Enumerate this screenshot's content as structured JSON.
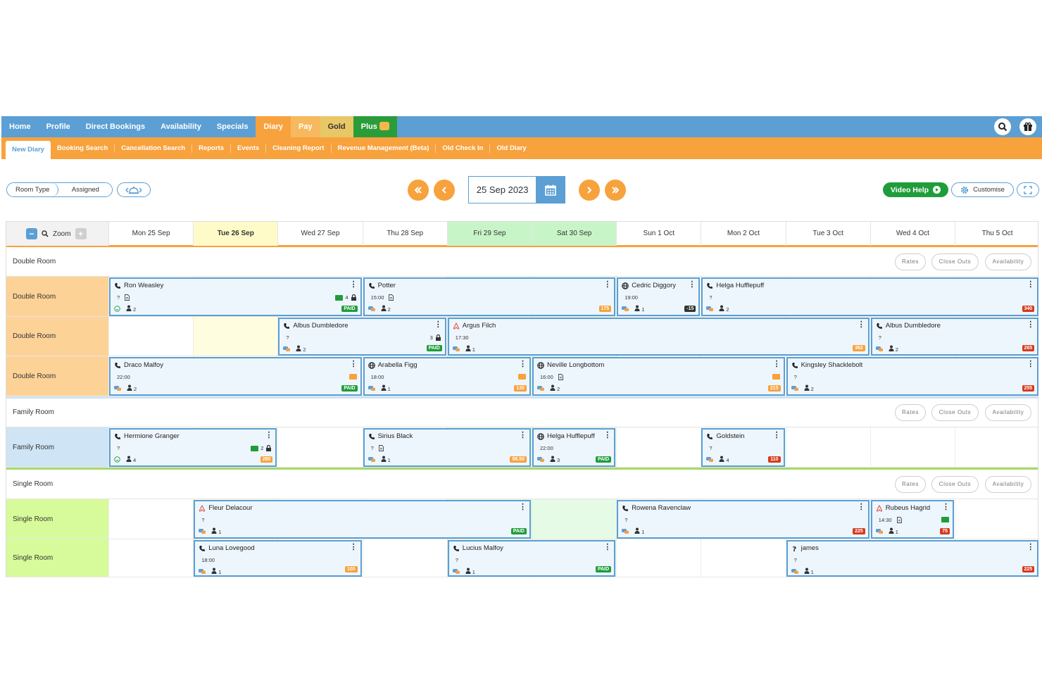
{
  "nav": {
    "items": [
      "Home",
      "Profile",
      "Direct Bookings",
      "Availability",
      "Specials",
      "Diary",
      "Pay",
      "Gold",
      "Plus"
    ]
  },
  "subnav": {
    "items": [
      "New Diary",
      "Booking Search",
      "Cancellation Search",
      "Reports",
      "Events",
      "Cleaning Report",
      "Revenue Management (Beta)",
      "Old Check In",
      "Old Diary"
    ]
  },
  "toolbar": {
    "room_type": "Room Type",
    "assigned": "Assigned",
    "date": "25 Sep 2023",
    "video_help": "Video Help",
    "customise": "Customise"
  },
  "grid": {
    "zoom_label": "Zoom",
    "days": [
      "Mon 25 Sep",
      "Tue 26 Sep",
      "Wed 27 Sep",
      "Thu 28 Sep",
      "Fri 29 Sep",
      "Sat 30 Sep",
      "Sun 1 Oct",
      "Mon 2 Oct",
      "Tue 3 Oct",
      "Wed 4 Oct",
      "Thu 5 Oct"
    ],
    "section_buttons": [
      "Rates",
      "Close Outs",
      "Availability"
    ],
    "sections": [
      {
        "title": "Double Room",
        "rooms": [
          "Double Room",
          "Double Room",
          "Double Room"
        ],
        "color": "#fdd297"
      },
      {
        "title": "Family Room",
        "rooms": [
          "Family Room"
        ],
        "color": "#cfe4f4"
      },
      {
        "title": "Single Room",
        "rooms": [
          "Single Room",
          "Single Room"
        ],
        "color": "#d7fb9a"
      }
    ]
  },
  "bookings": [
    {
      "name": "Ron Weasley",
      "time": "?",
      "guests": "2",
      "price": "PAID",
      "pc": "green",
      "extra": "4",
      "src": "phone"
    },
    {
      "name": "Potter",
      "time": "15:00",
      "guests": "2",
      "price": "175",
      "pc": "orange",
      "src": "phone"
    },
    {
      "name": "Cedric Diggory",
      "time": "19:00",
      "guests": "1",
      "price": "-15",
      "pc": "dark",
      "src": "globe"
    },
    {
      "name": "Helga Hufflepuff",
      "time": "?",
      "guests": "2",
      "price": "340",
      "pc": "red",
      "src": "phone"
    },
    {
      "name": "Albus Dumbledore",
      "time": "?",
      "guests": "2",
      "price": "PAID",
      "pc": "green",
      "extra": "3",
      "src": "phone"
    },
    {
      "name": "Argus Filch",
      "time": "17:30",
      "guests": "1",
      "price": "362",
      "pc": "orange",
      "src": "airbnb"
    },
    {
      "name": "Albus Dumbledore",
      "time": "?",
      "guests": "2",
      "price": "265",
      "pc": "red",
      "src": "phone"
    },
    {
      "name": "Draco Malfoy",
      "time": "22:00",
      "guests": "2",
      "price": "PAID",
      "pc": "green",
      "src": "phone"
    },
    {
      "name": "Arabella Figg",
      "time": "18:00",
      "guests": "1",
      "price": "130",
      "pc": "orange",
      "src": "globe"
    },
    {
      "name": "Neville Longbottom",
      "time": "16:00",
      "guests": "2",
      "price": "215",
      "pc": "orange",
      "src": "globe"
    },
    {
      "name": "Kingsley Shacklebolt",
      "time": "?",
      "guests": "2",
      "price": "255",
      "pc": "red",
      "src": "phone"
    },
    {
      "name": "Hermione Granger",
      "time": "?",
      "guests": "4",
      "price": "280",
      "pc": "orange",
      "extra": "2",
      "src": "phone"
    },
    {
      "name": "Sirius Black",
      "time": "?",
      "guests": "1",
      "price": "58.50",
      "pc": "orange",
      "src": "phone"
    },
    {
      "name": "Helga Hufflepuff",
      "time": "22:00",
      "guests": "3",
      "price": "PAID",
      "pc": "green",
      "src": "globe"
    },
    {
      "name": "Goldstein",
      "time": "?",
      "guests": "4",
      "price": "110",
      "pc": "red",
      "src": "phone"
    },
    {
      "name": "Fleur Delacour",
      "time": "?",
      "guests": "1",
      "price": "PAID",
      "pc": "green",
      "src": "airbnb"
    },
    {
      "name": "Rowena Ravenclaw",
      "time": "?",
      "guests": "1",
      "price": "225",
      "pc": "red",
      "src": "phone"
    },
    {
      "name": "Rubeus Hagrid",
      "time": "14:30",
      "guests": "1",
      "price": "75",
      "pc": "red",
      "src": "airbnb"
    },
    {
      "name": "Luna Lovegood",
      "time": "18:00",
      "guests": "1",
      "price": "100",
      "pc": "orange",
      "src": "phone"
    },
    {
      "name": "Lucius Malfoy",
      "time": "?",
      "guests": "1",
      "price": "PAID",
      "pc": "green",
      "src": "phone"
    },
    {
      "name": "james",
      "time": "?",
      "guests": "1",
      "price": "225",
      "pc": "red",
      "src": "question"
    }
  ]
}
